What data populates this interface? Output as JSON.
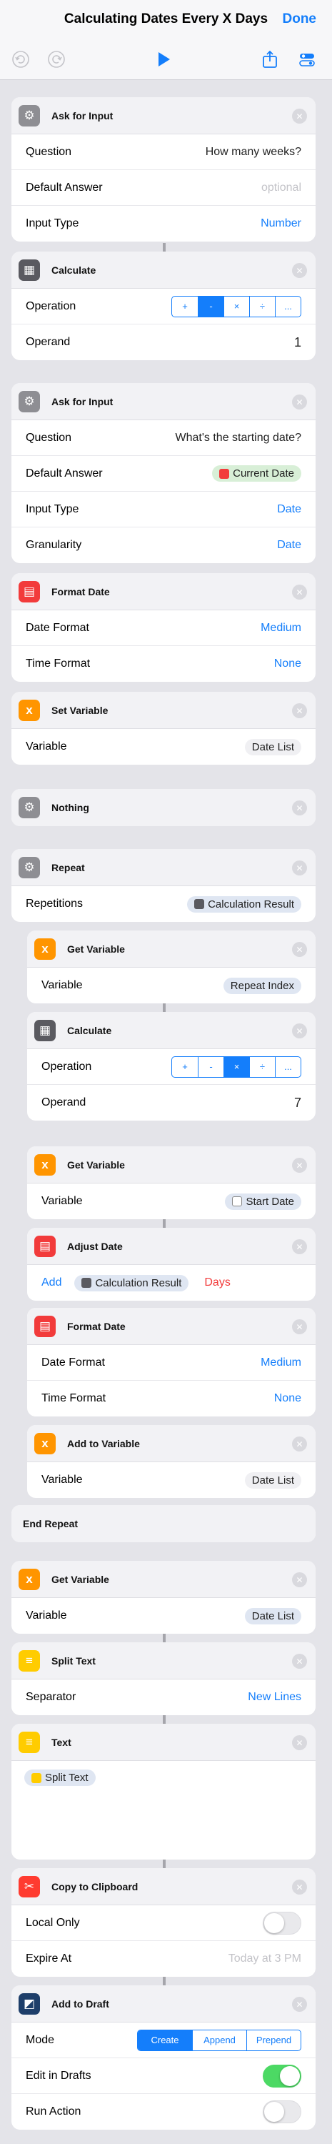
{
  "header": {
    "title": "Calculating Dates Every X Days",
    "done": "Done"
  },
  "colors": {
    "accent": "#147efb",
    "gear": "#8e8e93",
    "calc": "#5a5a60",
    "date": "#f23b3b",
    "variable": "#ff9500",
    "text": "#ffcc00",
    "clipboard": "#ff3b30",
    "drafts": "#1e3f6a",
    "toggle_on": "#4cd964"
  },
  "toolbar": {
    "icons": [
      "undo-icon",
      "redo-icon",
      "play-icon",
      "share-icon",
      "settings-icon"
    ]
  },
  "actions": [
    {
      "title": "Ask for Input",
      "icon": "gear-icon",
      "rows": [
        {
          "label": "Question",
          "value": "How many weeks?"
        },
        {
          "label": "Default Answer",
          "value": "optional"
        },
        {
          "label": "Input Type",
          "value": "Number"
        }
      ]
    },
    {
      "title": "Calculate",
      "icon": "calculator-icon",
      "rows": [
        {
          "label": "Operation",
          "options": [
            "+",
            "-",
            "×",
            "÷",
            "..."
          ],
          "selected": "-"
        },
        {
          "label": "Operand",
          "value": "1"
        }
      ]
    },
    {
      "title": "Ask for Input",
      "icon": "gear-icon",
      "rows": [
        {
          "label": "Question",
          "value": "What's the starting date?"
        },
        {
          "label": "Default Answer",
          "value": "Current Date"
        },
        {
          "label": "Input Type",
          "value": "Date"
        },
        {
          "label": "Granularity",
          "value": "Date"
        }
      ]
    },
    {
      "title": "Format Date",
      "icon": "calendar-icon",
      "rows": [
        {
          "label": "Date Format",
          "value": "Medium"
        },
        {
          "label": "Time Format",
          "value": "None"
        }
      ]
    },
    {
      "title": "Set Variable",
      "icon": "variable-icon",
      "rows": [
        {
          "label": "Variable",
          "value": "Date List"
        }
      ]
    },
    {
      "title": "Nothing",
      "icon": "gear-icon"
    },
    {
      "title": "Repeat",
      "icon": "gear-icon",
      "rows": [
        {
          "label": "Repetitions",
          "value": "Calculation Result"
        }
      ]
    },
    {
      "title": "Get Variable",
      "icon": "variable-icon",
      "rows": [
        {
          "label": "Variable",
          "value": "Repeat Index"
        }
      ]
    },
    {
      "title": "Calculate",
      "icon": "calculator-icon",
      "rows": [
        {
          "label": "Operation",
          "options": [
            "+",
            "-",
            "×",
            "÷",
            "..."
          ],
          "selected": "×"
        },
        {
          "label": "Operand",
          "value": "7"
        }
      ]
    },
    {
      "title": "Get Variable",
      "icon": "variable-icon",
      "rows": [
        {
          "label": "Variable",
          "value": "Start Date"
        }
      ]
    },
    {
      "title": "Adjust Date",
      "icon": "calendar-icon",
      "rows": [
        {
          "add": "Add",
          "value": "Calculation Result",
          "unit": "Days"
        }
      ]
    },
    {
      "title": "Format Date",
      "icon": "calendar-icon",
      "rows": [
        {
          "label": "Date Format",
          "value": "Medium"
        },
        {
          "label": "Time Format",
          "value": "None"
        }
      ]
    },
    {
      "title": "Add to Variable",
      "icon": "variable-icon",
      "rows": [
        {
          "label": "Variable",
          "value": "Date List"
        }
      ]
    },
    {
      "title": "End Repeat"
    },
    {
      "title": "Get Variable",
      "icon": "variable-icon",
      "rows": [
        {
          "label": "Variable",
          "value": "Date List"
        }
      ]
    },
    {
      "title": "Split Text",
      "icon": "text-icon",
      "rows": [
        {
          "label": "Separator",
          "value": "New Lines"
        }
      ]
    },
    {
      "title": "Text",
      "icon": "text-icon",
      "rows": [
        {
          "value": "Split Text"
        }
      ]
    },
    {
      "title": "Copy to Clipboard",
      "icon": "scissors-icon",
      "rows": [
        {
          "label": "Local Only",
          "on": false
        },
        {
          "label": "Expire At",
          "value": "Today at 3 PM"
        }
      ]
    },
    {
      "title": "Add to Draft",
      "icon": "drafts-icon",
      "rows": [
        {
          "label": "Mode",
          "options": [
            "Create",
            "Append",
            "Prepend"
          ],
          "selected": "Create"
        },
        {
          "label": "Edit in Drafts",
          "on": true
        },
        {
          "label": "Run Action",
          "on": false
        }
      ]
    }
  ]
}
